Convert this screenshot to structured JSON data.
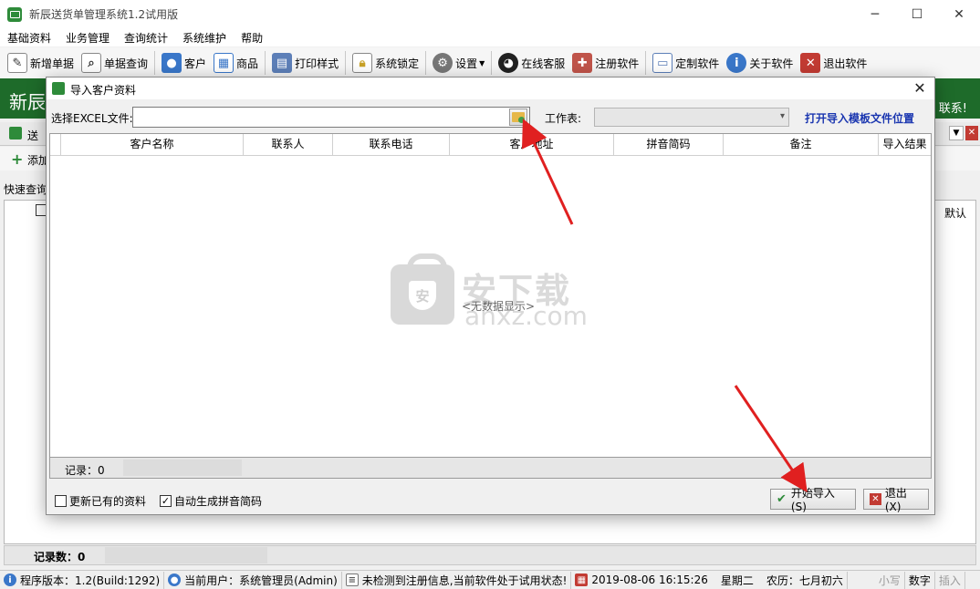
{
  "window": {
    "title": "新辰送货单管理系统1.2试用版",
    "controls": {
      "minimize": "─",
      "maximize": "☐",
      "close": "✕"
    }
  },
  "menu": {
    "items": [
      "基础资料",
      "业务管理",
      "查询统计",
      "系统维护",
      "帮助"
    ]
  },
  "toolbar": {
    "items": [
      {
        "label": "新增单据",
        "icon": "new-document-icon"
      },
      {
        "label": "单据查询",
        "icon": "document-search-icon"
      },
      {
        "label": "客户",
        "icon": "customers-icon"
      },
      {
        "label": "商品",
        "icon": "products-icon"
      },
      {
        "label": "打印样式",
        "icon": "print-style-icon"
      },
      {
        "label": "系统锁定",
        "icon": "lock-icon"
      },
      {
        "label": "设置",
        "icon": "gear-icon"
      },
      {
        "label": "在线客服",
        "icon": "qq-icon"
      },
      {
        "label": "注册软件",
        "icon": "register-icon"
      },
      {
        "label": "定制软件",
        "icon": "customize-icon"
      },
      {
        "label": "关于软件",
        "icon": "info-icon"
      },
      {
        "label": "退出软件",
        "icon": "exit-icon"
      }
    ]
  },
  "banner": {
    "title": "新辰",
    "right_text": "联系!"
  },
  "doc_tab": {
    "label": "送"
  },
  "subbar": {
    "add_label": "添加"
  },
  "quick_query": {
    "label": "快速查询"
  },
  "main_grid": {
    "default_col": "默认"
  },
  "main_record": {
    "label": "记录数：0"
  },
  "dialog": {
    "title": "导入客户资料",
    "close": "✕",
    "excel_label": "选择EXCEL文件:",
    "excel_value": "",
    "sheet_label": "工作表:",
    "sheet_value": "",
    "open_template_link": "打开导入模板文件位置",
    "columns": [
      "客户名称",
      "联系人",
      "联系电话",
      "客户地址",
      "拼音简码",
      "备注",
      "导入结果"
    ],
    "no_data": "<无数据显示>",
    "record_label": "记录：0",
    "update_existing_label": "更新已有的资料",
    "update_existing_checked": false,
    "auto_pinyin_label": "自动生成拼音简码",
    "auto_pinyin_checked": true,
    "start_button": "开始导入(S)",
    "exit_button": "退出(X)"
  },
  "watermark": {
    "cn": "安下载",
    "en": "anxz.com",
    "shield": "安"
  },
  "statusbar": {
    "version": "程序版本：1.2(Build:1292)",
    "user": "当前用户：系统管理员(Admin)",
    "notice": "未检测到注册信息,当前软件处于试用状态!",
    "datetime": "2019-08-06 16:15:26",
    "weekday": "星期二",
    "lunar": "农历：七月初六",
    "caps": "小写",
    "num": "数字",
    "insert": "插入"
  },
  "colors": {
    "brand_green": "#1e6b2a",
    "link_blue": "#1a36b0",
    "arrow_red": "#e02020"
  }
}
